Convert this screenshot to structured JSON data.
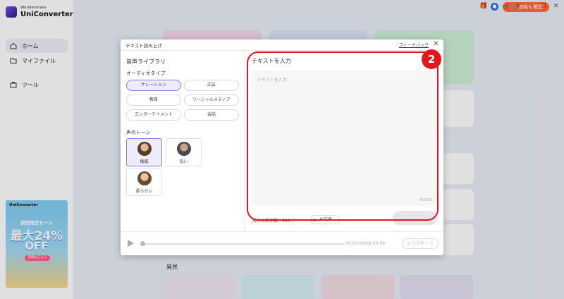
{
  "app": {
    "logo_line1": "Wondershare",
    "logo_line2": "UniConverter"
  },
  "sidebar": {
    "items": [
      {
        "label": "ホーム",
        "icon": "home-icon",
        "active": true
      },
      {
        "label": "マイファイル",
        "icon": "folder-icon",
        "active": false
      },
      {
        "label": "ツール",
        "icon": "toolbox-icon",
        "active": false
      }
    ]
  },
  "promo": {
    "brand": "UniConverter",
    "sale": "期間限定セール",
    "percent": "最大24%",
    "off": "OFF",
    "cta": "詳細はこちら"
  },
  "topbar": {
    "price_button": "価格を確認",
    "accent_color": "#ff6a3d"
  },
  "modal": {
    "title": "テキスト読み上げ",
    "feedback": "フィードバック",
    "library_title": "音声ライブラリ",
    "audio_type_title": "オーディオタイプ",
    "audio_types": [
      "ナレーション",
      "広告",
      "教育",
      "ソーシャルメディア",
      "エンターテイメント",
      "会話"
    ],
    "selected_audio_type": "ナレーション",
    "tone_title": "声のトーン",
    "tones": [
      "権威",
      "低い",
      "柔らかい"
    ],
    "selected_tone": "権威",
    "input_title": "テキストを入力",
    "placeholder": "テキストを入力",
    "counter": "0/2000",
    "chars_left": "残りの文字数：500",
    "ai_button": "AI文章",
    "time": "00:00:00/00:00:00",
    "export": "エクスポート"
  },
  "annotation": {
    "badge": "2",
    "color": "#e2161f"
  },
  "discover_title": "発見"
}
